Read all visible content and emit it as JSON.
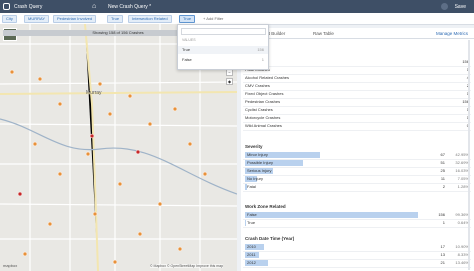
{
  "topbar": {
    "app_name": "Crash Query",
    "query_title": "New Crash Query *",
    "save_label": "Save"
  },
  "filters": [
    {
      "label": "City"
    },
    {
      "label": "MURRAY"
    },
    {
      "label": "Pedestrian Involved"
    },
    {
      "label": "True"
    },
    {
      "label": "Intersection Related"
    },
    {
      "label": "True"
    }
  ],
  "add_filter_label": "+ Add Filter",
  "dropdown": {
    "header": "VALUES",
    "rows": [
      {
        "label": "True",
        "count": "156"
      },
      {
        "label": "False",
        "count": "1"
      }
    ]
  },
  "map": {
    "showing_text": "Showing 158 of 156 Crashes",
    "city_label": "Murray",
    "logo": "mapbox",
    "attribution": "© Mapbox © OpenStreetMap Improve this map"
  },
  "tabs": [
    {
      "label": "Chart Builder"
    },
    {
      "label": "Raw Table"
    }
  ],
  "manage_metrics_label": "Manage Metrics",
  "metrics": [
    {
      "label": "Crashes",
      "count": "156",
      "pct": ""
    },
    {
      "label": "Fatal Crashes",
      "count": "1",
      "pct": ""
    },
    {
      "label": "Alcohol Related Crashes",
      "count": "4",
      "pct": ""
    },
    {
      "label": "CMV Crashes",
      "count": "2",
      "pct": ""
    },
    {
      "label": "Fixed Object Crashes",
      "count": "1",
      "pct": ""
    },
    {
      "label": "Pedestrian Crashes",
      "count": "156",
      "pct": ""
    },
    {
      "label": "Cyclist Crashes",
      "count": "1",
      "pct": ""
    },
    {
      "label": "Motorcycle Crashes",
      "count": "1",
      "pct": ""
    },
    {
      "label": "Wild Animal Crashes",
      "count": "0",
      "pct": ""
    }
  ],
  "severity": {
    "title": "Severity",
    "rows": [
      {
        "label": "Minor Injury",
        "count": "67",
        "pct": "42.95%",
        "fraction": 0.43
      },
      {
        "label": "Possible Injury",
        "count": "51",
        "pct": "32.69%",
        "fraction": 0.33
      },
      {
        "label": "Serious Injury",
        "count": "25",
        "pct": "16.03%",
        "fraction": 0.16
      },
      {
        "label": "No Injury",
        "count": "11",
        "pct": "7.05%",
        "fraction": 0.07
      },
      {
        "label": "Fatal",
        "count": "2",
        "pct": "1.28%",
        "fraction": 0.013
      }
    ]
  },
  "work_zone": {
    "title": "Work Zone Related",
    "rows": [
      {
        "label": "False",
        "count": "156",
        "pct": "99.36%",
        "fraction": 0.99
      },
      {
        "label": "True",
        "count": "1",
        "pct": "0.64%",
        "fraction": 0.006
      }
    ]
  },
  "crash_year": {
    "title": "Crash Date Time (Year)",
    "rows": [
      {
        "label": "2010",
        "count": "17",
        "pct": "10.90%",
        "fraction": 0.11
      },
      {
        "label": "2011",
        "count": "13",
        "pct": "8.33%",
        "fraction": 0.08
      },
      {
        "label": "2012",
        "count": "21",
        "pct": "13.46%",
        "fraction": 0.13
      }
    ]
  }
}
